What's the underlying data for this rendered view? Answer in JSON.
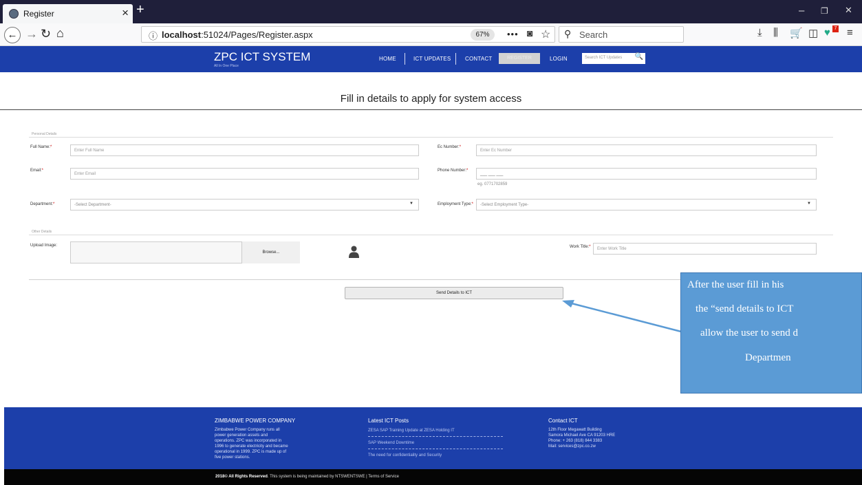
{
  "browser": {
    "tab_title": "Register",
    "tab_close": "×",
    "new_tab": "+",
    "url_host": "localhost",
    "url_rest": ":51024/Pages/Register.aspx",
    "zoom": "67%",
    "search_placeholder": "Search",
    "window_min": "–",
    "window_max": "❐",
    "window_close": "✕"
  },
  "site": {
    "brand": "ZPC ICT SYSTEM",
    "tagline": "All In One Place",
    "nav": {
      "home": "HOME",
      "updates": "ICT UPDATES",
      "contact": "CONTACT",
      "register": "REGISTER",
      "login": "LOGIN"
    },
    "search_placeholder": "Search ICT Updates"
  },
  "form": {
    "title": "Fill in details to apply for system access",
    "personal_section": "Personal Details",
    "other_section": "Other Details",
    "full_name": {
      "label": "Full Name:",
      "placeholder": "Enter Full Name"
    },
    "ec_number": {
      "label": "Ec Number:",
      "placeholder": "Enter Ec Number"
    },
    "email": {
      "label": "Email:",
      "placeholder": "Enter Email"
    },
    "phone": {
      "label": "Phone Number:",
      "placeholder": "___ ___ ___",
      "hint": "eg. 0771702859"
    },
    "department": {
      "label": "Department:",
      "selected": "-Select Department-"
    },
    "employment_type": {
      "label": "Employment Type:",
      "selected": "-Select Employment Type-"
    },
    "upload": {
      "label": "Upload Image:",
      "browse": "Browse..."
    },
    "work_title": {
      "label": "Work Title:",
      "placeholder": "Enter Work Title"
    },
    "required_mark": "*",
    "submit": "Send Details to ICT"
  },
  "callout": {
    "lines": [
      "After the user fill in his",
      "the “send details to ICT",
      "allow the user to send d",
      "Departmen"
    ]
  },
  "footer": {
    "company_heading": "ZIMBABWE POWER COMPANY",
    "company_lines": [
      "Zimbabwe Power Company runs all",
      "power generation assets and",
      "operations. ZPC was incorporated in",
      "1996 to generate electricity and became",
      "operational in 1999. ZPC is made up of",
      "five power stations."
    ],
    "posts_heading": "Latest ICT Posts",
    "posts": [
      "ZESA SAP Training Update at ZESA Holding IT",
      "SAP Weekend Downtime",
      "The need for confidentiality and Security"
    ],
    "contact_heading": "Contact ICT",
    "contact_lines": [
      "12th Floor Megawatt Building",
      "Samora Michael Ave CA 91203 HRE",
      "Phone: + 263 (818) 844 3383",
      "Mail: services@zpc.co.zw"
    ],
    "copyright_bold": "2018© All Rights Reserved",
    "copyright_rest": ". This system is being maintained by NTSWENTSWE | Terms of Service"
  }
}
